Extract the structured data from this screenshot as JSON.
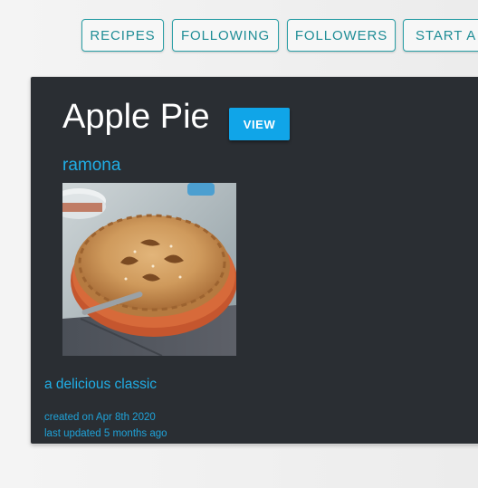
{
  "nav": {
    "recipes": "RECIPES",
    "following": "FOLLOWING",
    "followers": "FOLLOWERS",
    "start": "START A"
  },
  "recipe": {
    "title": "Apple Pie",
    "view_label": "VIEW",
    "author": "ramona",
    "image_alt": "apple-pie-photo",
    "description": "a delicious classic",
    "created": "created on Apr 8th 2020",
    "updated": "last updated 5 months ago"
  },
  "colors": {
    "accent": "#10a5e8",
    "link": "#20aee6",
    "card_bg": "#2a2e33",
    "nav_border": "#2a9fa6"
  }
}
